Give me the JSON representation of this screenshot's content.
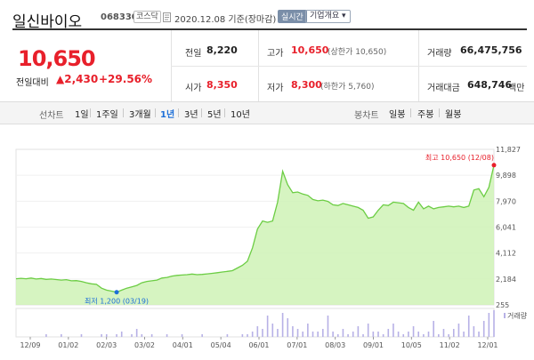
{
  "header": {
    "stock_name": "일신바이오",
    "code": "068330",
    "market": "코스닥",
    "date_text": "2020.12.08 기준(장마감)",
    "realtime_label": "실시간",
    "company_button": "기업개요 ▾"
  },
  "summary": {
    "price": "10,650",
    "change_label": "전일대비",
    "change_value": "▲2,430",
    "change_pct": "+29.56%",
    "prev_close_label": "전일",
    "prev_close": "8,220",
    "open_label": "시가",
    "open": "8,350",
    "high_label": "고가",
    "high": "10,650",
    "high_note": "(상한가 10,650)",
    "low_label": "저가",
    "low": "8,300",
    "low_note": "(하한가 5,760)",
    "volume_label": "거래량",
    "volume": "66,475,756",
    "amount_label": "거래대금",
    "amount": "648,746",
    "amount_unit": "백만"
  },
  "toolbar": {
    "line_label": "선차트",
    "periods": [
      "1일",
      "1주일",
      "3개월",
      "1년",
      "3년",
      "5년",
      "10년"
    ],
    "active_period": "1년",
    "candle_label": "봉차트",
    "candle_periods": [
      "일봉",
      "주봉",
      "월봉"
    ]
  },
  "colors": {
    "price_up": "#e8202b",
    "line": "#6ccd44",
    "area_fill": "#cff2b6",
    "volume_bar": "#b7b1e6",
    "active_tab": "#1d6fd8"
  },
  "chart_data": {
    "type": "area",
    "y_ticks": [
      "11,827",
      "9,898",
      "7,970",
      "6,041",
      "4,112",
      "2,184",
      "255"
    ],
    "ylim": [
      255,
      11827
    ],
    "x_ticks": [
      "12/09",
      "01/02",
      "02/03",
      "03/02",
      "04/01",
      "05/04",
      "06/01",
      "07/01",
      "08/03",
      "09/01",
      "10/05",
      "11/02",
      "12/01"
    ],
    "high_annotation": "최고 10,650 (12/08)",
    "low_annotation": "최저 1,200 (03/19)",
    "volume_legend": "거래량",
    "series": [
      {
        "values": [
          2200,
          2230,
          2200,
          2250,
          2180,
          2220,
          2150,
          2180,
          2140,
          2100,
          2130,
          2050,
          2060,
          2000,
          1900,
          1820,
          1780,
          1500,
          1350,
          1280,
          1200,
          1350,
          1500,
          1600,
          1700,
          1900,
          2000,
          2050,
          2100,
          2250,
          2300,
          2400,
          2450,
          2480,
          2500,
          2550,
          2500,
          2520,
          2560,
          2600,
          2650,
          2700,
          2750,
          2800,
          3000,
          3200,
          3500,
          4500,
          5900,
          6500,
          6400,
          6500,
          7900,
          10200,
          9200,
          8600,
          8650,
          8500,
          8400,
          8100,
          8000,
          8050,
          7950,
          7700,
          7650,
          7800,
          7700,
          7600,
          7500,
          7300,
          6700,
          6800,
          7300,
          7700,
          7650,
          7900,
          7850,
          7800,
          7500,
          7300,
          7900,
          7400,
          7600,
          7400,
          7500,
          7550,
          7600,
          7550,
          7600,
          7500,
          7600,
          8800,
          8900,
          8300,
          9000,
          10650
        ],
        "volume": [
          0,
          0,
          0,
          0,
          0,
          0,
          1,
          0,
          0,
          1,
          0,
          0,
          0,
          1,
          0,
          0,
          0,
          1,
          1,
          0,
          1,
          2,
          0,
          1,
          3,
          1,
          0,
          1,
          0,
          0,
          1,
          0,
          0,
          1,
          0,
          0,
          0,
          1,
          0,
          0,
          0,
          0,
          1,
          0,
          0,
          1,
          1,
          2,
          4,
          3,
          8,
          5,
          3,
          9,
          7,
          4,
          3,
          2,
          5,
          2,
          2,
          3,
          8,
          2,
          1,
          3,
          1,
          2,
          4,
          1,
          5,
          2,
          2,
          1,
          3,
          5,
          2,
          1,
          2,
          4,
          2,
          1,
          2,
          6,
          1,
          3,
          1,
          3,
          5,
          2,
          8,
          4,
          2,
          6,
          9,
          10
        ]
      }
    ]
  }
}
